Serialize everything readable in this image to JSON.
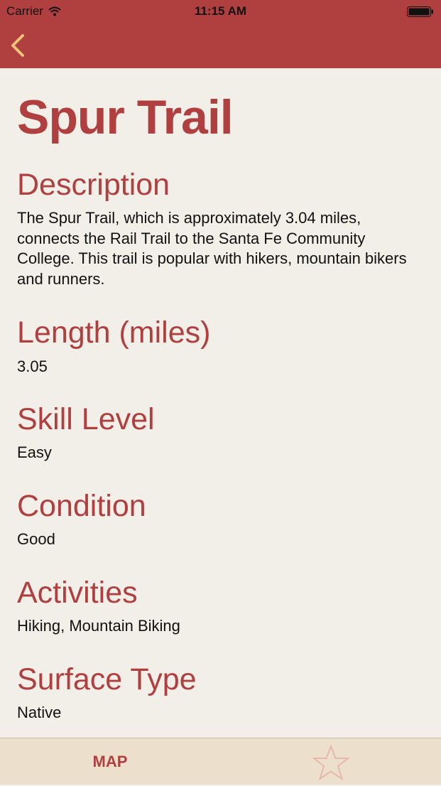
{
  "status_bar": {
    "carrier": "Carrier",
    "time": "11:15 AM"
  },
  "nav": {
    "back_icon": "chevron-left-icon"
  },
  "trail": {
    "name": "Spur Trail",
    "sections": [
      {
        "heading": "Description",
        "value": "The Spur Trail, which is approximately 3.04 miles, connects the Rail Trail to the Santa Fe Community College. This trail is popular with hikers, mountain bikers and runners."
      },
      {
        "heading": "Length (miles)",
        "value": "3.05"
      },
      {
        "heading": "Skill Level",
        "value": "Easy"
      },
      {
        "heading": "Condition",
        "value": "Good"
      },
      {
        "heading": "Activities",
        "value": "Hiking, Mountain Biking"
      },
      {
        "heading": "Surface Type",
        "value": "Native"
      }
    ]
  },
  "tab_bar": {
    "map_label": "MAP",
    "favorite_icon": "star-outline-icon"
  },
  "colors": {
    "accent": "#b03f40",
    "background": "#f2efe8",
    "tab_bar": "#ecdfcc",
    "back_arrow": "#f0c27a",
    "star_outline": "#e6b9ac"
  }
}
